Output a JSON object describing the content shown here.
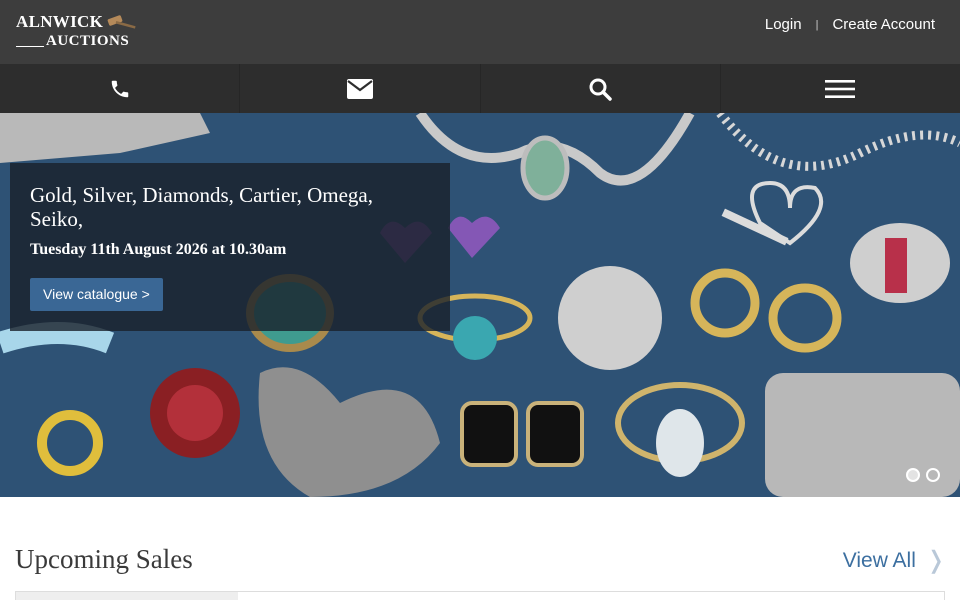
{
  "brand": {
    "logo_line1": "ALNWICK",
    "logo_line2": "AUCTIONS"
  },
  "auth": {
    "login": "Login",
    "separator": "|",
    "create_account": "Create Account"
  },
  "nav": {
    "icons": [
      "phone-icon",
      "envelope-icon",
      "search-icon",
      "hamburger-menu-icon"
    ]
  },
  "hero": {
    "title": "Gold, Silver, Diamonds, Cartier, Omega, Seiko,",
    "date": "Tuesday 11th August 2026 at 10.30am",
    "cta": "View catalogue >",
    "slides_total": 2,
    "slide_active": 2
  },
  "upcoming": {
    "title": "Upcoming Sales",
    "view_all": "View All",
    "chevron": "❭"
  },
  "colors": {
    "topbar": "#3d3d3d",
    "navbar": "#2d2d2d",
    "hero_bg": "#2e5275",
    "accent": "#3a6795",
    "link": "#3c6fa0"
  }
}
